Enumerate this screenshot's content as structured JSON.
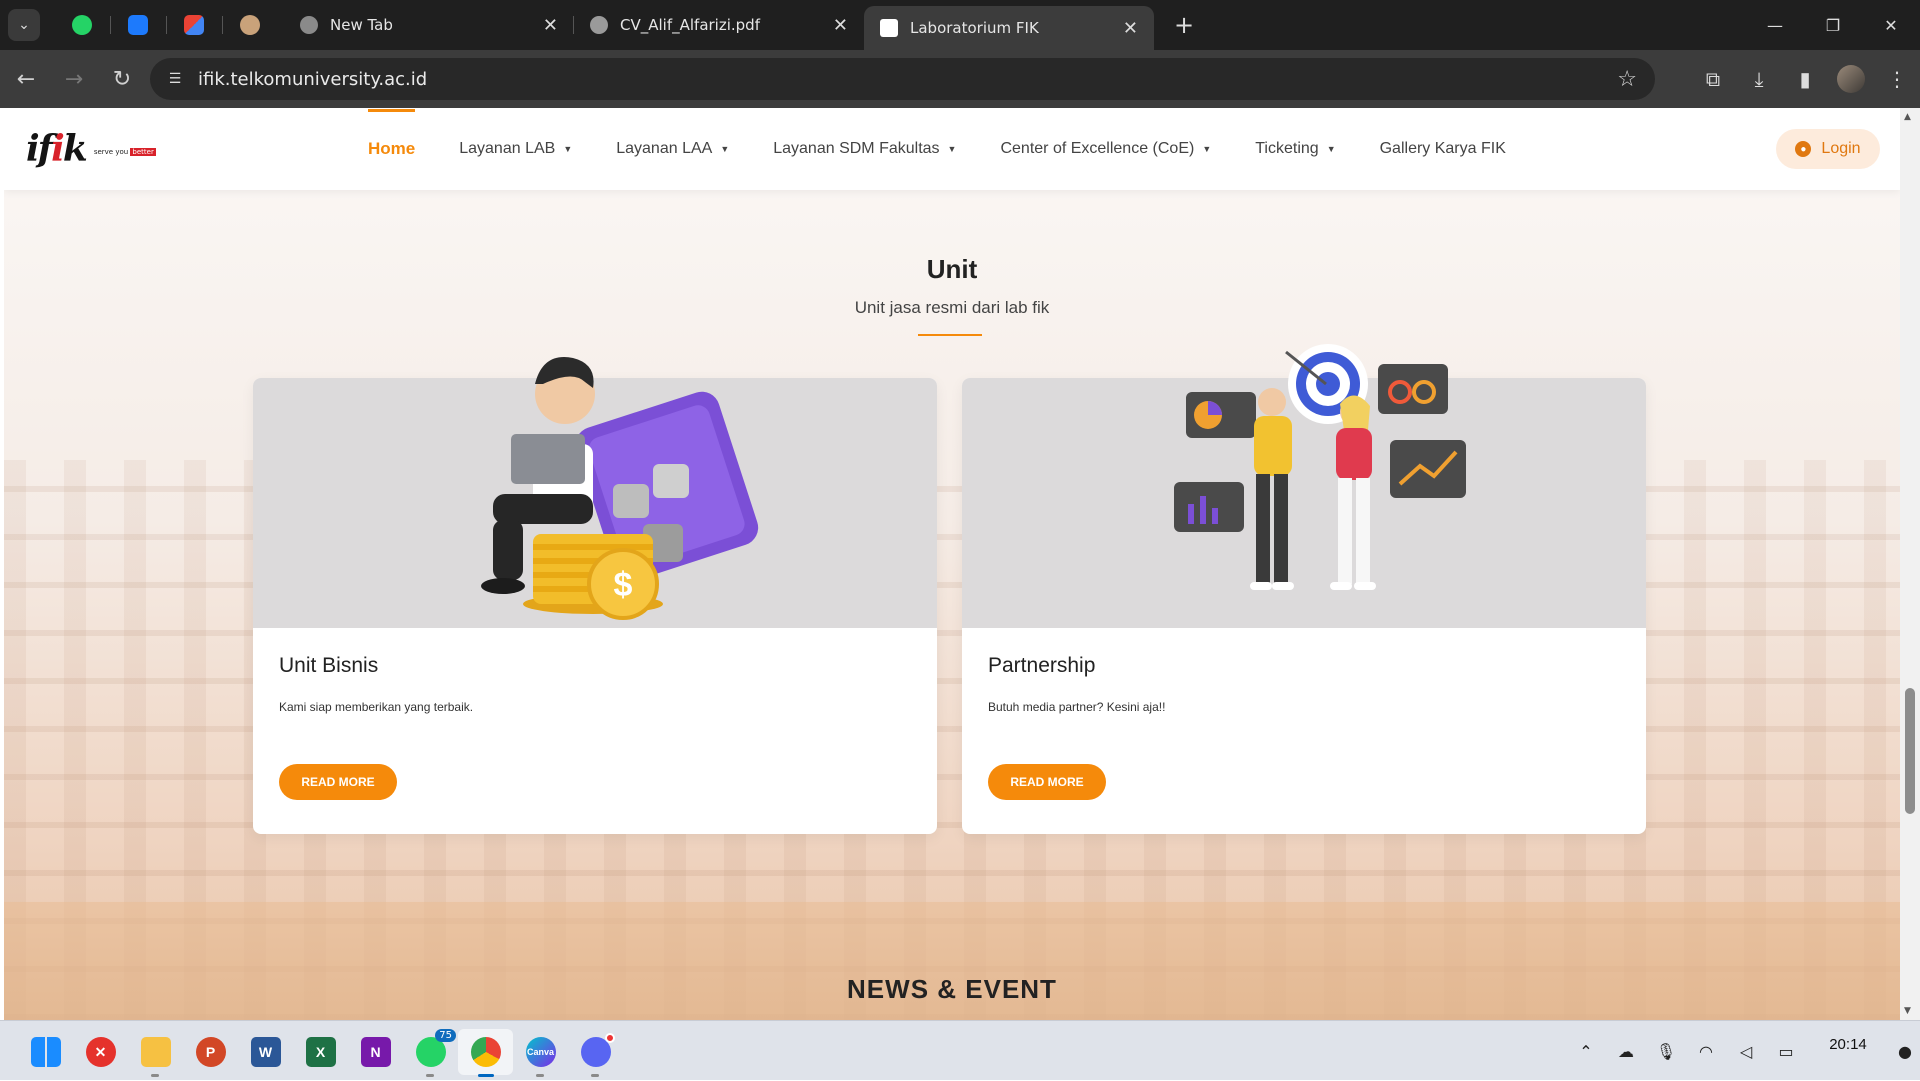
{
  "browser": {
    "tabs": [
      {
        "title": "New Tab"
      },
      {
        "title": "CV_Alif_Alfarizi.pdf"
      },
      {
        "title": "Laboratorium FIK",
        "active": true
      }
    ],
    "url": "ifik.telkomuniversity.ac.id"
  },
  "site": {
    "logo_tag": "serve you",
    "logo_tag_highlight": "better",
    "nav": [
      {
        "label": "Home",
        "active": true
      },
      {
        "label": "Layanan LAB",
        "dropdown": true
      },
      {
        "label": "Layanan LAA",
        "dropdown": true
      },
      {
        "label": "Layanan SDM Fakultas",
        "dropdown": true
      },
      {
        "label": "Center of Excellence (CoE)",
        "dropdown": true
      },
      {
        "label": "Ticketing",
        "dropdown": true
      },
      {
        "label": "Gallery Karya FIK"
      }
    ],
    "login_label": "Login",
    "accent": "#f58a0b"
  },
  "unit_section": {
    "title": "Unit",
    "subtitle": "Unit jasa resmi dari lab fik",
    "cards": [
      {
        "title": "Unit Bisnis",
        "description": "Kami siap memberikan yang terbaik.",
        "button": "READ MORE"
      },
      {
        "title": "Partnership",
        "description": "Butuh media partner? Kesini aja!!",
        "button": "READ MORE"
      }
    ]
  },
  "news_section": {
    "title": "NEWS & EVENT"
  },
  "taskbar": {
    "whatsapp_badge": "75",
    "time": "20:14"
  }
}
